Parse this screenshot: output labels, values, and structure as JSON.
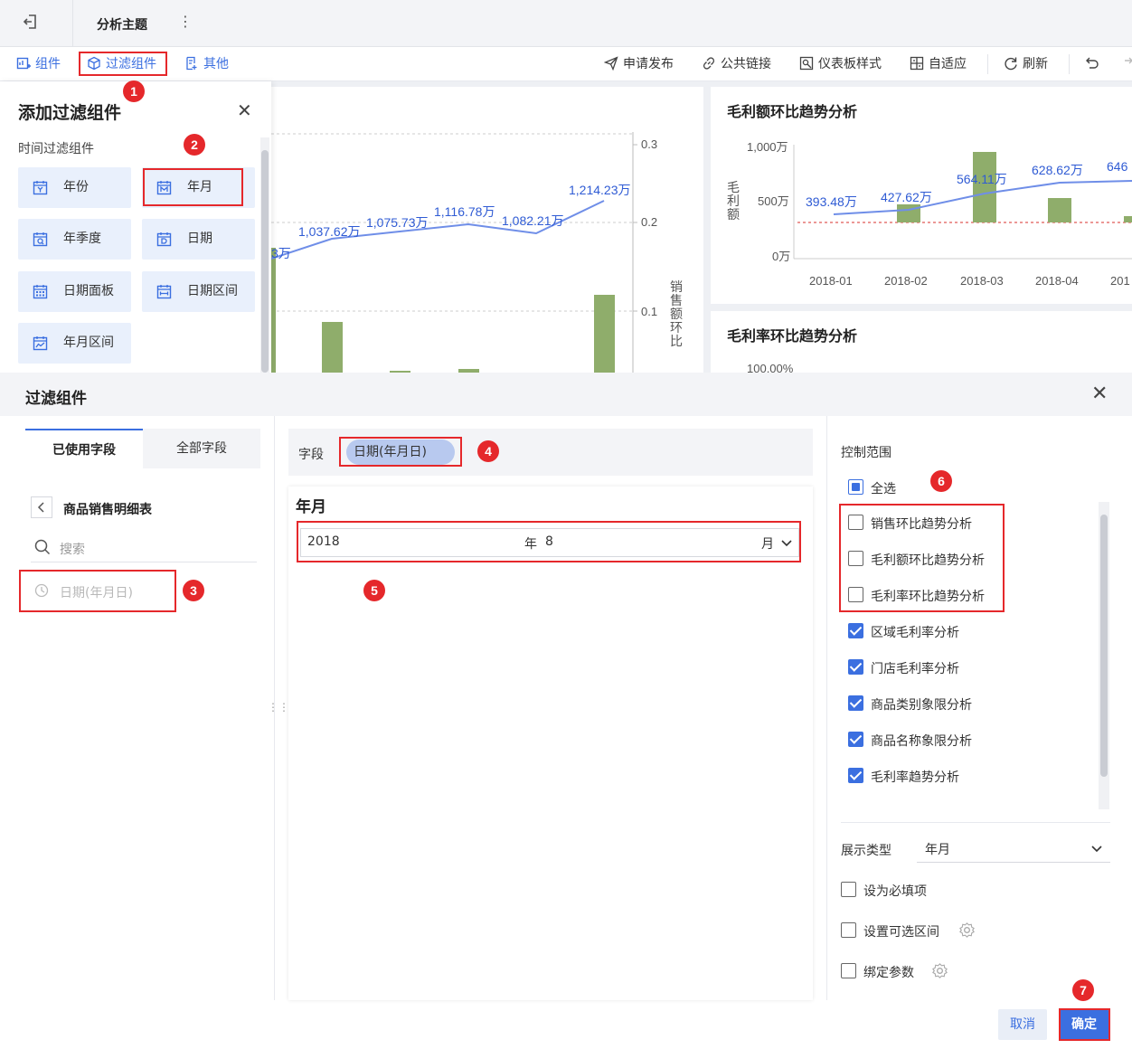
{
  "header": {
    "title": "分析主题"
  },
  "toolbar": {
    "left": [
      "组件",
      "过滤组件",
      "其他"
    ],
    "right": [
      "申请发布",
      "公共链接",
      "仪表板样式",
      "自适应",
      "刷新"
    ]
  },
  "chart1": {
    "right_ticks": [
      "0.3",
      "0.2",
      "0.1"
    ],
    "ylabel_right": "销售额环比",
    "labels": [
      "3万",
      "1,037.62万",
      "1,075.73万",
      "1,116.78万",
      "1,082.21万",
      "1,214.23万"
    ]
  },
  "chart2": {
    "title": "毛利额环比趋势分析",
    "ylabel": "毛利额",
    "yticks": [
      "1,000万",
      "500万",
      "0万"
    ],
    "xticks": [
      "2018-01",
      "2018-02",
      "2018-03",
      "2018-04",
      "201"
    ],
    "labels": [
      "393.48万",
      "427.62万",
      "564.11万",
      "628.62万",
      "646"
    ]
  },
  "chart3": {
    "title": "毛利率环比趋势分析",
    "ytick": "100.00%"
  },
  "add_panel": {
    "title": "添加过滤组件",
    "section": "时间过滤组件",
    "buttons": [
      "年份",
      "年月",
      "年季度",
      "日期",
      "日期面板",
      "日期区间",
      "年月区间"
    ]
  },
  "modal": {
    "title": "过滤组件",
    "tabs": [
      "已使用字段",
      "全部字段"
    ],
    "table_name": "商品销售明细表",
    "search_placeholder": "搜索",
    "field_item": "日期(年月日)",
    "field_label": "字段",
    "field_chip": "日期(年月日)",
    "preview_title": "年月",
    "picker": {
      "year": "2018",
      "year_unit": "年",
      "month": "8",
      "month_unit": "月"
    },
    "scope_title": "控制范围",
    "select_all": "全选",
    "scope_items": [
      {
        "label": "销售环比趋势分析",
        "checked": false
      },
      {
        "label": "毛利额环比趋势分析",
        "checked": false
      },
      {
        "label": "毛利率环比趋势分析",
        "checked": false
      },
      {
        "label": "区域毛利率分析",
        "checked": true
      },
      {
        "label": "门店毛利率分析",
        "checked": true
      },
      {
        "label": "商品类别象限分析",
        "checked": true
      },
      {
        "label": "商品名称象限分析",
        "checked": true
      },
      {
        "label": "毛利率趋势分析",
        "checked": true
      }
    ],
    "display_type_label": "展示类型",
    "display_type_value": "年月",
    "options": [
      "设为必填项",
      "设置可选区间",
      "绑定参数"
    ],
    "cancel": "取消",
    "confirm": "确定"
  },
  "steps": [
    "1",
    "2",
    "3",
    "4",
    "5",
    "6",
    "7"
  ],
  "colors": {
    "accent": "#3b6fe0",
    "bar": "#8fad6b",
    "highlight": "#e5282b"
  }
}
